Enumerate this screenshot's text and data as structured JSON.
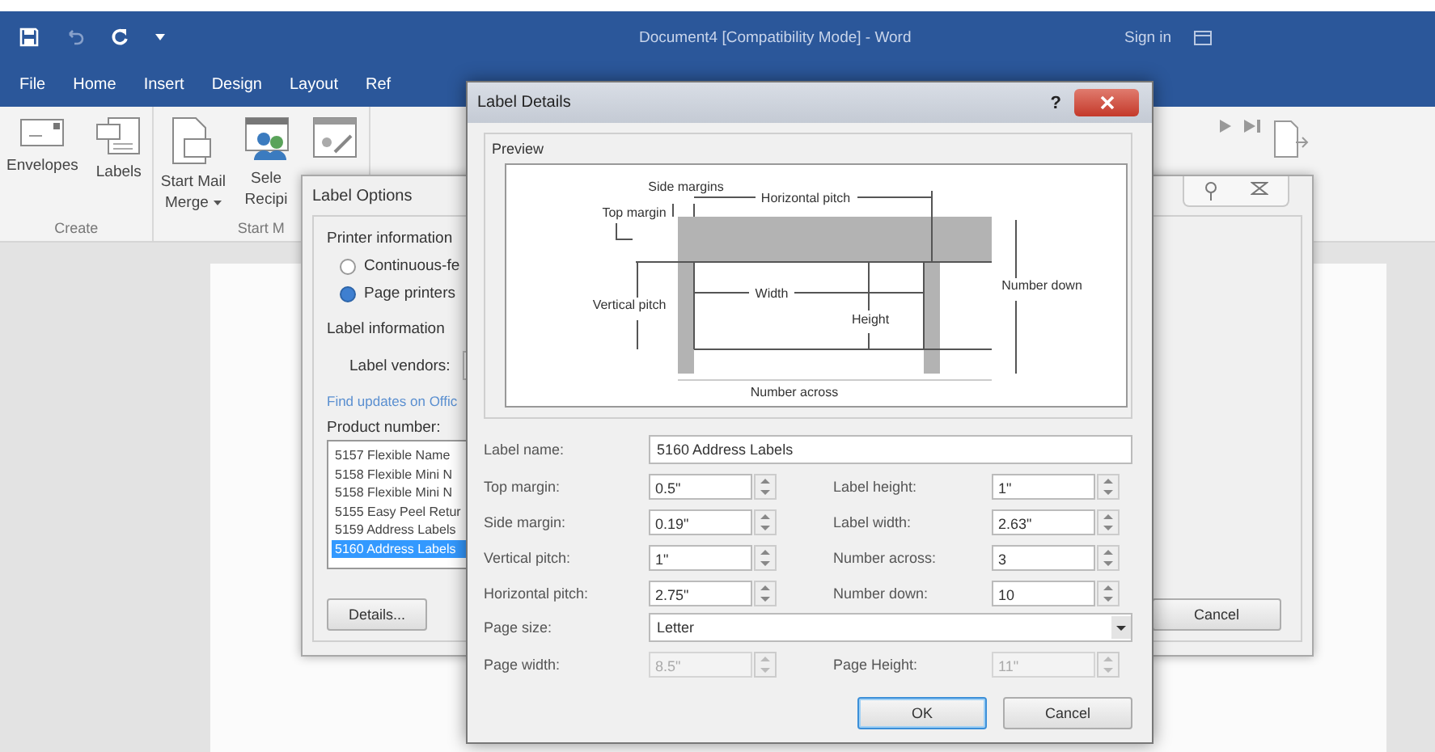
{
  "window": {
    "title": "Document4 [Compatibility Mode] - Word",
    "sign_in": "Sign in"
  },
  "ribbon_tabs": [
    {
      "label": "File",
      "selected": false
    },
    {
      "label": "Home",
      "selected": false
    },
    {
      "label": "Insert",
      "selected": false
    },
    {
      "label": "Design",
      "selected": false
    },
    {
      "label": "Layout",
      "selected": false
    },
    {
      "label": "Ref",
      "selected": false
    }
  ],
  "ribbon_groups": [
    {
      "label": "Create",
      "buttons": [
        {
          "kind": "envelope",
          "lines": [
            "Envelopes"
          ]
        },
        {
          "kind": "labels",
          "lines": [
            "Labels"
          ]
        }
      ]
    },
    {
      "label": "Start M",
      "buttons": [
        {
          "kind": "document",
          "lines": [
            "Start Mail",
            "Merge"
          ],
          "dropdown": true
        },
        {
          "kind": "people",
          "lines": [
            "Sele",
            "Recipi"
          ]
        },
        {
          "kind": "edit"
        }
      ]
    }
  ],
  "label_options": {
    "title": "Label Options",
    "printer_information": "Printer information",
    "printer_types": [
      {
        "label": "Continuous-fe",
        "selected": false
      },
      {
        "label": "Page printers",
        "selected": true
      }
    ],
    "label_information": "Label information",
    "vendor_label": "Label vendors:",
    "link": "Find updates on Offic",
    "product_label": "Product number:",
    "products": [
      {
        "label": "5157 Flexible Name",
        "selected": false
      },
      {
        "label": "5158 Flexible Mini N",
        "selected": false
      },
      {
        "label": "5158 Flexible Mini N",
        "selected": false
      },
      {
        "label": "5155 Easy Peel Retur",
        "selected": false
      },
      {
        "label": "5159 Address Labels",
        "selected": false
      },
      {
        "label": "5160 Address Labels",
        "selected": true
      }
    ],
    "details_button": "Details...",
    "cancel_button": "Cancel"
  },
  "label_details": {
    "title": "Label Details",
    "help": "?",
    "preview_title": "Preview",
    "diagram_labels": [
      "Side margins",
      "Top margin",
      "Horizontal pitch",
      "Vertical pitch",
      "Width",
      "Height",
      "Number down",
      "Number across"
    ],
    "label_name": {
      "label": "Label name:",
      "value": "5160 Address Labels"
    },
    "fields": [
      {
        "label": "Top margin:",
        "value": "0.5\""
      },
      {
        "label": "Label height:",
        "value": "1\""
      },
      {
        "label": "Side margin:",
        "value": "0.19\""
      },
      {
        "label": "Label width:",
        "value": "2.63\""
      },
      {
        "label": "Vertical pitch:",
        "value": "1\""
      },
      {
        "label": "Number across:",
        "value": "3"
      },
      {
        "label": "Horizontal pitch:",
        "value": "2.75\""
      },
      {
        "label": "Number down:",
        "value": "10"
      }
    ],
    "page_size": {
      "label": "Page size:",
      "value": "Letter"
    },
    "page_fields": [
      {
        "label": "Page width:",
        "value": "8.5\"",
        "disabled": true
      },
      {
        "label": "Page Height:",
        "value": "11\"",
        "disabled": true
      }
    ],
    "ok_button": "OK",
    "cancel_button": "Cancel"
  }
}
